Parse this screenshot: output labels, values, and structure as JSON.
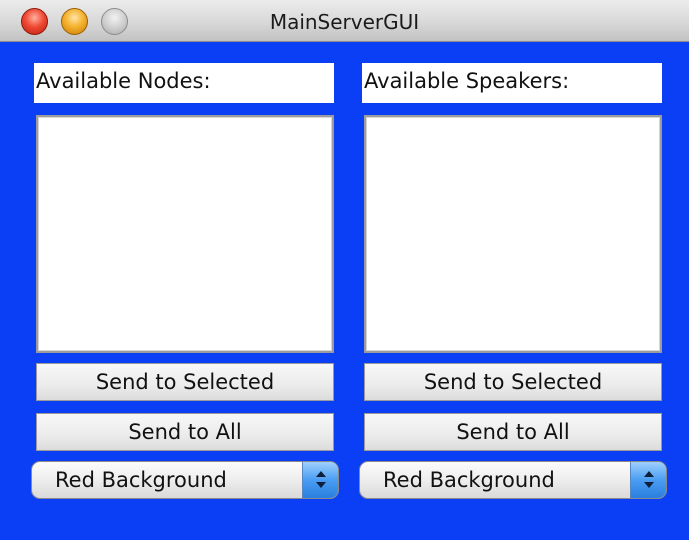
{
  "window": {
    "title": "MainServerGUI"
  },
  "colors": {
    "background": "#0a3ff5",
    "titlebar": "#d8d8d8",
    "close_button": "#f04a35",
    "minimize_button": "#f5b22e",
    "zoom_button": "#cfcfcf",
    "select_arrow": "#4a9df2"
  },
  "nodes_panel": {
    "label": "Available Nodes:",
    "list_items": [],
    "send_selected_label": "Send to Selected",
    "send_all_label": "Send to All",
    "background_select_value": "Red Background"
  },
  "speakers_panel": {
    "label": "Available Speakers:",
    "list_items": [],
    "send_selected_label": "Send to Selected",
    "send_all_label": "Send to All",
    "background_select_value": "Red Background"
  }
}
